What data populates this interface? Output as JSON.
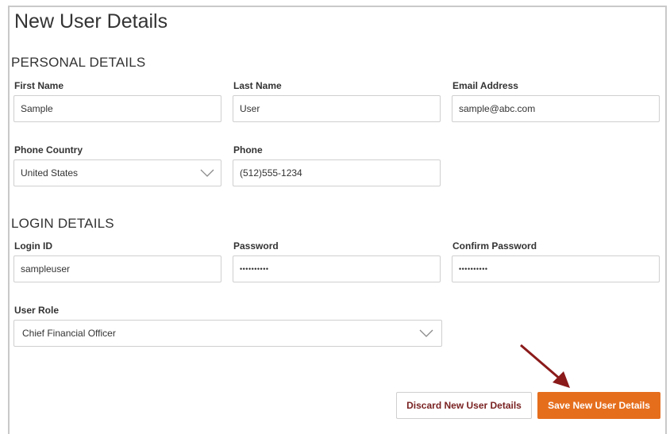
{
  "page": {
    "title": "New User Details"
  },
  "personal": {
    "heading": "PERSONAL DETAILS",
    "first_name": {
      "label": "First Name",
      "value": "Sample"
    },
    "last_name": {
      "label": "Last Name",
      "value": "User"
    },
    "email": {
      "label": "Email Address",
      "value": "sample@abc.com"
    },
    "phone_country": {
      "label": "Phone Country",
      "value": "United States"
    },
    "phone": {
      "label": "Phone",
      "value": "(512)555-1234"
    }
  },
  "login": {
    "heading": "LOGIN DETAILS",
    "login_id": {
      "label": "Login ID",
      "value": "sampleuser"
    },
    "password": {
      "label": "Password",
      "value": "••••••••••"
    },
    "confirm_password": {
      "label": "Confirm Password",
      "value": "••••••••••"
    },
    "user_role": {
      "label": "User Role",
      "value": "Chief Financial Officer"
    }
  },
  "actions": {
    "discard_label": "Discard New User Details",
    "save_label": "Save New User Details"
  },
  "colors": {
    "accent": "#e56e1d",
    "discard_text": "#7a2222",
    "annotation_arrow": "#8b1a1a"
  }
}
